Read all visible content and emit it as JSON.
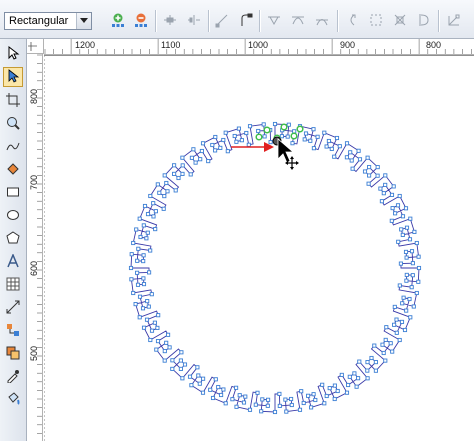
{
  "toolbar": {
    "mode_value": "Rectangular",
    "icons": [
      "add-node-icon",
      "delete-node-icon",
      "join-nodes-icon",
      "break-curve-icon",
      "to-line-icon",
      "to-curve-icon",
      "cusp-node-icon",
      "smooth-node-icon",
      "symmetrical-node-icon",
      "reverse-direction-icon",
      "extend-curve-icon",
      "extract-subpath-icon",
      "stretch-nodes-icon",
      "rotate-nodes-icon",
      "align-nodes-icon",
      "reflect-nodes-icon"
    ]
  },
  "tools": [
    "pick-tool-icon",
    "shape-tool-icon",
    "crop-tool-icon",
    "zoom-tool-icon",
    "freehand-tool-icon",
    "smart-fill-icon",
    "rectangle-tool-icon",
    "ellipse-tool-icon",
    "polygon-tool-icon",
    "text-tool-icon",
    "table-tool-icon",
    "dimension-tool-icon",
    "connector-tool-icon",
    "interactive-fill-icon",
    "eyedropper-tool-icon",
    "fill-tool-icon"
  ],
  "rulers": {
    "horizontal": [
      "1200",
      "1100",
      "1000",
      "900",
      "800"
    ],
    "vertical": [
      "800",
      "700",
      "600",
      "500"
    ]
  },
  "colors": {
    "path": "#3a3aa8",
    "node": "#3b7fd4",
    "selected_node": "#3fbf4a",
    "direction_arrow": "#e02020"
  }
}
